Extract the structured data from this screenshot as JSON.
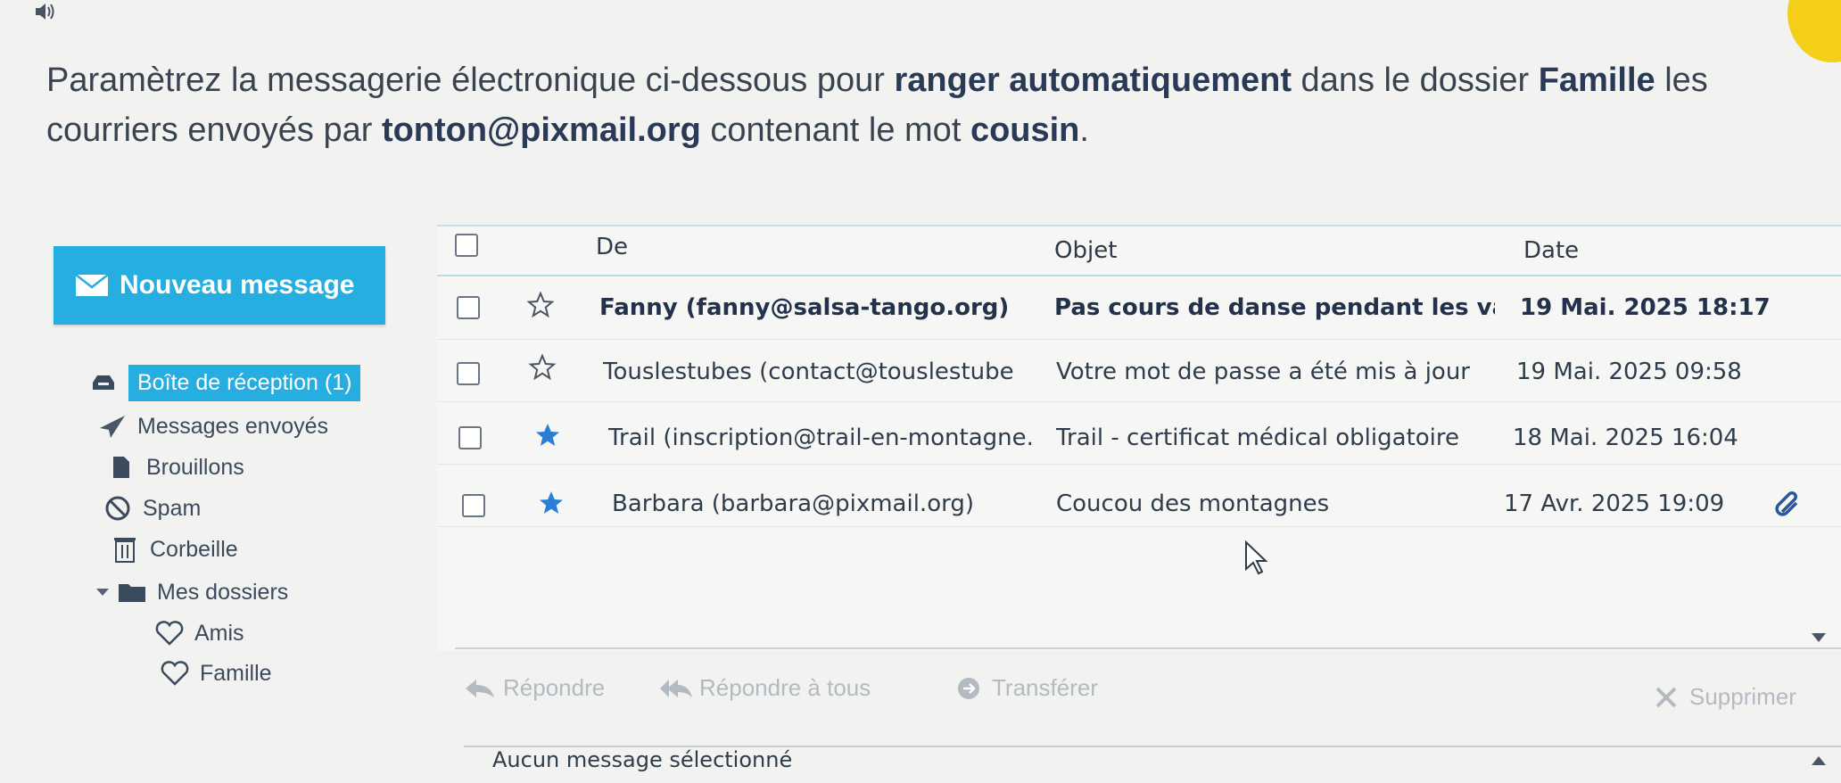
{
  "instruction": {
    "part1": "Paramètrez la messagerie électronique ci-dessous pour ",
    "bold1": "ranger automatiquement",
    "part2": " dans le dossier ",
    "bold2": "Famille",
    "part3": " les courriers envoyés par ",
    "bold3": "tonton@pixmail.org",
    "part4": " contenant le mot ",
    "bold4": "cousin",
    "part5": "."
  },
  "new_message_label": "Nouveau message",
  "folders": [
    {
      "label": "Boîte de réception (1)",
      "icon": "inbox-icon"
    },
    {
      "label": "Messages envoyés",
      "icon": "paper-plane-icon"
    },
    {
      "label": "Brouillons",
      "icon": "draft-icon"
    },
    {
      "label": "Spam",
      "icon": "ban-icon"
    },
    {
      "label": "Corbeille",
      "icon": "trash-icon"
    },
    {
      "label": "Mes dossiers",
      "icon": "folder-icon"
    },
    {
      "label": "Amis",
      "icon": "heart-icon"
    },
    {
      "label": "Famille",
      "icon": "heart-icon"
    }
  ],
  "list": {
    "headers": {
      "from": "De",
      "subject": "Objet",
      "date": "Date"
    },
    "rows": [
      {
        "from": "Fanny (fanny@salsa-tango.org)",
        "subject": "Pas cours de danse pendant les vac",
        "date": "19 Mai. 2025 18:17",
        "starred": false,
        "unread": true
      },
      {
        "from": "Touslestubes (contact@touslestube",
        "subject": "Votre mot de passe a été mis à jour",
        "date": "19 Mai. 2025 09:58",
        "starred": false,
        "unread": false
      },
      {
        "from": "Trail (inscription@trail-en-montagne.",
        "subject": "Trail - certificat médical obligatoire",
        "date": "18 Mai. 2025 16:04",
        "starred": true,
        "unread": false
      },
      {
        "from": "Barbara (barbara@pixmail.org)",
        "subject": "Coucou des montagnes",
        "date": "17 Avr. 2025 19:09",
        "starred": true,
        "unread": false,
        "attachment": true
      }
    ]
  },
  "toolbar": {
    "reply": "Répondre",
    "reply_all": "Répondre à tous",
    "forward": "Transférer",
    "delete": "Supprimer"
  },
  "preview_text": "Aucun message sélectionné",
  "colors": {
    "accent": "#27aee0",
    "star": "#2a7fd4",
    "disabled": "#b3bac2"
  }
}
